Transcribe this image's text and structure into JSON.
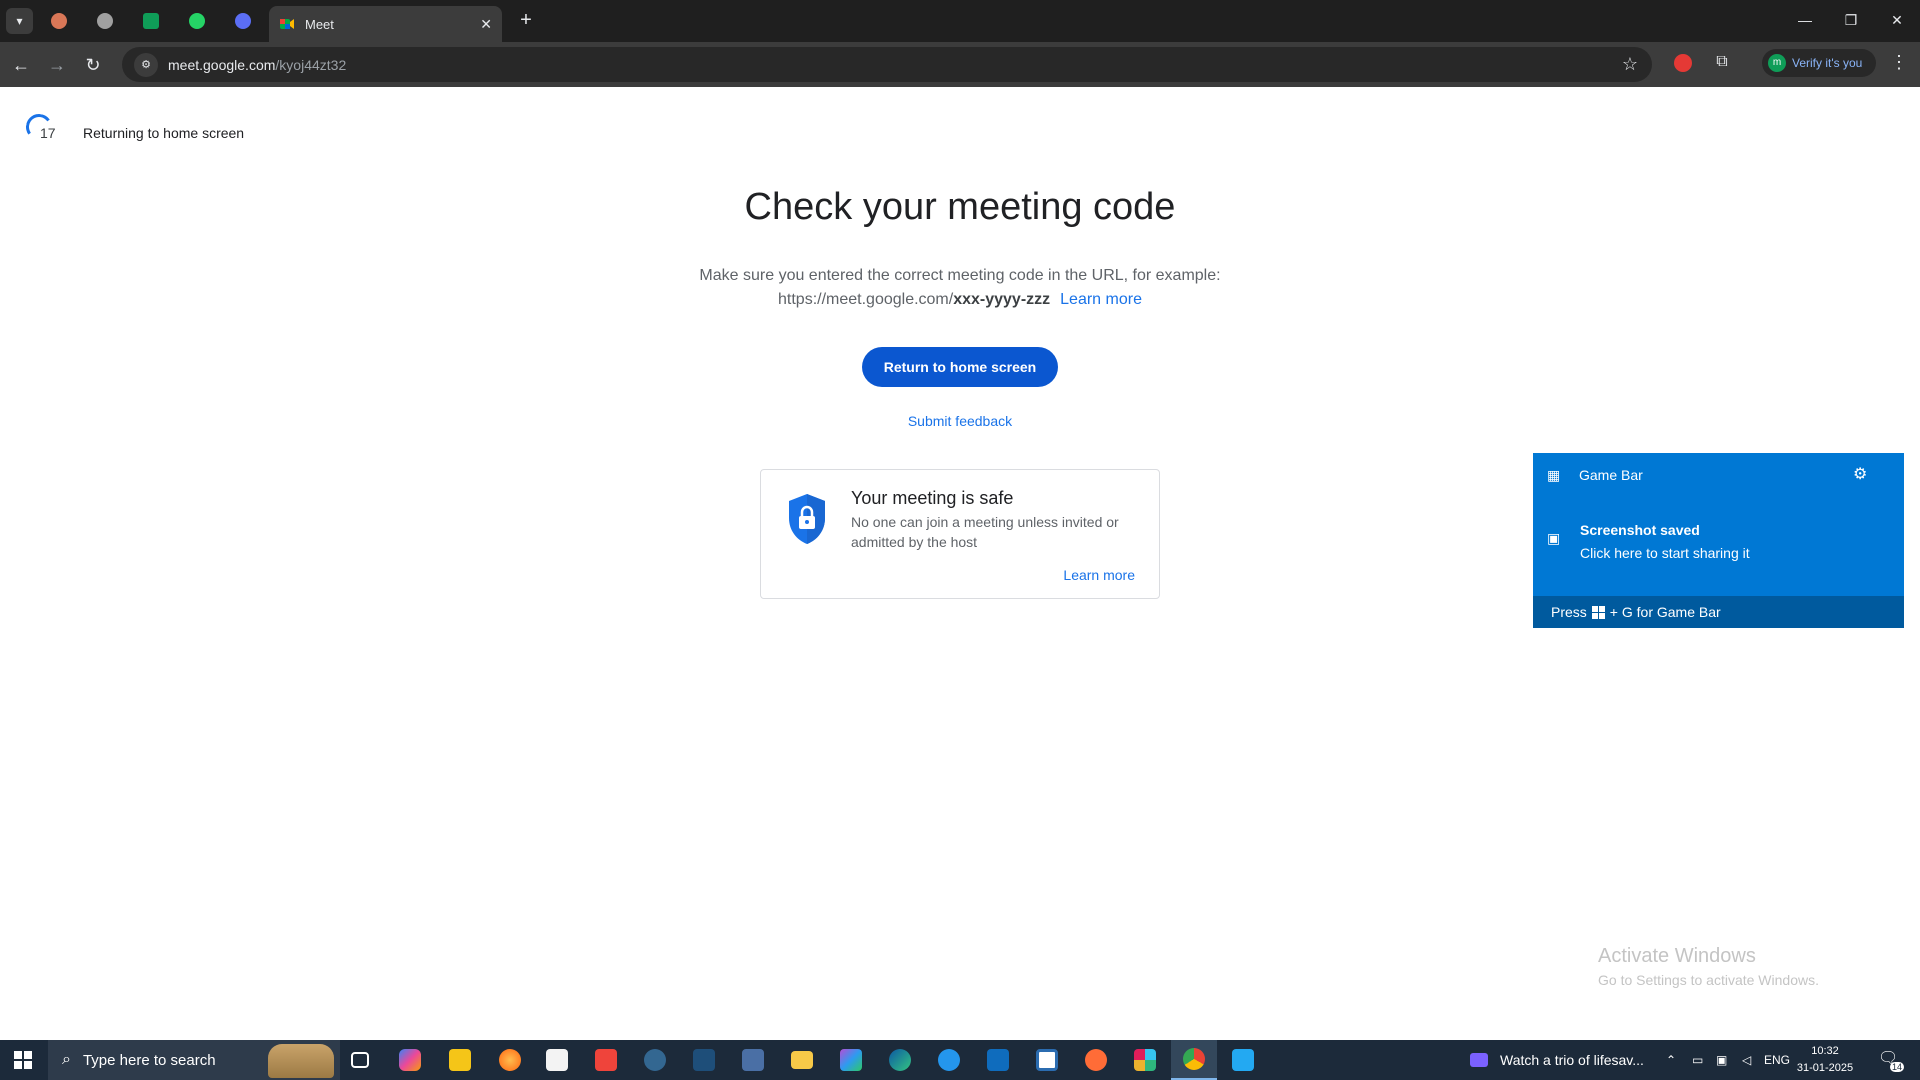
{
  "browser": {
    "active_tab_title": "Meet",
    "new_tab_symbol": "+",
    "url_host": "meet.google.com",
    "url_path": "/kyoj44zt32",
    "verify_label": "Verify it's you",
    "verify_avatar_letter": "m"
  },
  "page": {
    "countdown_number": "17",
    "returning_text": "Returning to home screen",
    "heading": "Check your meeting code",
    "description_line1": "Make sure you entered the correct meeting code in the URL, for example:",
    "example_url_prefix": "https://meet.google.com/",
    "example_code": "xxx-yyyy-zzz",
    "learn_more_link": "Learn more",
    "return_button": "Return to home screen",
    "feedback_link": "Submit feedback",
    "safe_card": {
      "title": "Your meeting is safe",
      "description": "No one can join a meeting unless invited or admitted by the host",
      "learn_more": "Learn more"
    }
  },
  "game_bar": {
    "title": "Game Bar",
    "saved_title": "Screenshot saved",
    "share_text": "Click here to start sharing it",
    "footer_press": "Press",
    "footer_rest": "+ G for Game Bar"
  },
  "watermark": {
    "line1": "Activate Windows",
    "line2": "Go to Settings to activate Windows."
  },
  "taskbar": {
    "search_placeholder": "Type here to search",
    "media_text": "Watch a trio of lifesav...",
    "language": "ENG",
    "time": "10:32",
    "date": "31-01-2025",
    "notification_count": "14"
  }
}
